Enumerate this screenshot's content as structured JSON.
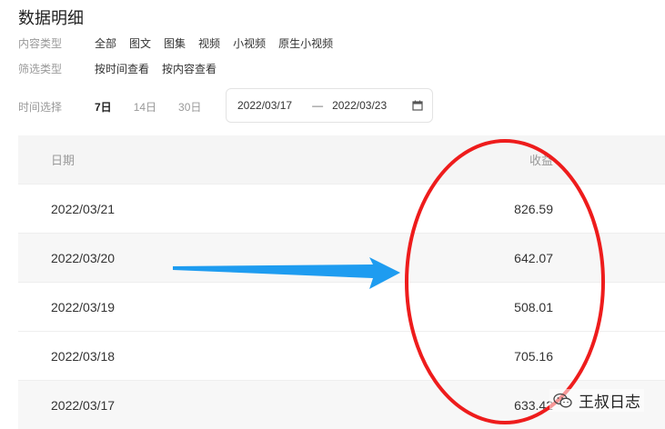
{
  "page": {
    "title": "数据明细"
  },
  "filters": {
    "content_type": {
      "label": "内容类型",
      "options": [
        "全部",
        "图文",
        "图集",
        "视频",
        "小视频",
        "原生小视频"
      ]
    },
    "filter_type": {
      "label": "筛选类型",
      "options": [
        "按时间查看",
        "按内容查看"
      ]
    },
    "time_select": {
      "label": "时间选择",
      "tabs": [
        "7日",
        "14日",
        "30日"
      ],
      "active": "7日",
      "start_date": "2022/03/17",
      "separator": "—",
      "end_date": "2022/03/23"
    }
  },
  "table": {
    "headers": {
      "date": "日期",
      "income": "收益"
    },
    "rows": [
      {
        "date": "2022/03/21",
        "income": "826.59"
      },
      {
        "date": "2022/03/20",
        "income": "642.07"
      },
      {
        "date": "2022/03/19",
        "income": "508.01"
      },
      {
        "date": "2022/03/18",
        "income": "705.16"
      },
      {
        "date": "2022/03/17",
        "income": "633.42"
      }
    ]
  },
  "annotations": {
    "arrow_color": "#1e9cf0",
    "ellipse_color": "#ee1c1c"
  },
  "watermark": {
    "text": "王叔日志"
  },
  "colors": {
    "header_bg": "#f5f5f5",
    "text": "#333333",
    "muted": "#999999"
  }
}
